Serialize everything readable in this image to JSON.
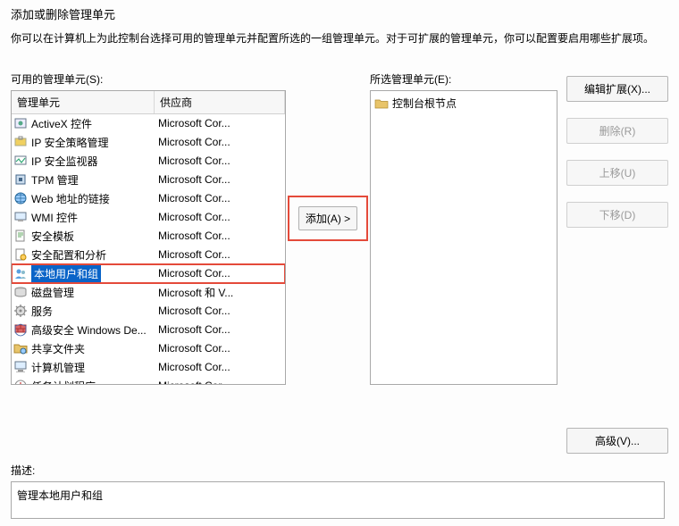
{
  "header": {
    "title": "添加或删除管理单元",
    "intro": "你可以在计算机上为此控制台选择可用的管理单元并配置所选的一组管理单元。对于可扩展的管理单元，你可以配置要启用哪些扩展项。"
  },
  "available": {
    "label": "可用的管理单元(S):",
    "columns": {
      "c1": "管理单元",
      "c2": "供应商"
    },
    "items": [
      {
        "icon": "activex",
        "name": "ActiveX 控件",
        "vendor": "Microsoft Cor..."
      },
      {
        "icon": "ipsec-policy",
        "name": "IP 安全策略管理",
        "vendor": "Microsoft Cor..."
      },
      {
        "icon": "ipsec-monitor",
        "name": "IP 安全监视器",
        "vendor": "Microsoft Cor..."
      },
      {
        "icon": "tpm",
        "name": "TPM 管理",
        "vendor": "Microsoft Cor..."
      },
      {
        "icon": "weblink",
        "name": "Web 地址的链接",
        "vendor": "Microsoft Cor..."
      },
      {
        "icon": "wmi",
        "name": "WMI 控件",
        "vendor": "Microsoft Cor..."
      },
      {
        "icon": "sectemplate",
        "name": "安全模板",
        "vendor": "Microsoft Cor..."
      },
      {
        "icon": "secconfig",
        "name": "安全配置和分析",
        "vendor": "Microsoft Cor..."
      },
      {
        "icon": "localusers",
        "name": "本地用户和组",
        "vendor": "Microsoft Cor...",
        "selected": true,
        "boxed": true
      },
      {
        "icon": "disk",
        "name": "磁盘管理",
        "vendor": "Microsoft 和 V..."
      },
      {
        "icon": "services",
        "name": "服务",
        "vendor": "Microsoft Cor..."
      },
      {
        "icon": "firewall",
        "name": "高级安全 Windows De...",
        "vendor": "Microsoft Cor..."
      },
      {
        "icon": "sharedfolders",
        "name": "共享文件夹",
        "vendor": "Microsoft Cor..."
      },
      {
        "icon": "computermgmt",
        "name": "计算机管理",
        "vendor": "Microsoft Cor..."
      },
      {
        "icon": "tasksched",
        "name": "任务计划程序",
        "vendor": "Microsoft Cor..."
      }
    ]
  },
  "selected": {
    "label": "所选管理单元(E):",
    "root": "控制台根节点"
  },
  "buttons": {
    "add": "添加(A) >",
    "edit_ext": "编辑扩展(X)...",
    "remove": "删除(R)",
    "move_up": "上移(U)",
    "move_down": "下移(D)",
    "advanced": "高级(V)..."
  },
  "description": {
    "label": "描述:",
    "text": "管理本地用户和组"
  }
}
